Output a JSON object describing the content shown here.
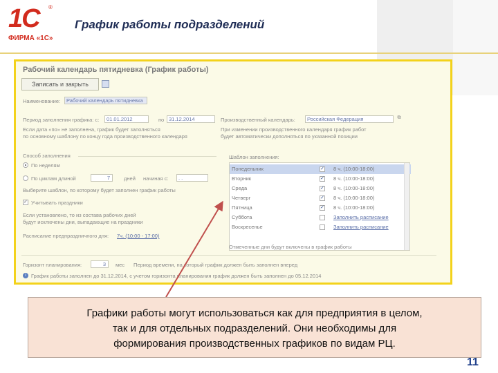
{
  "slide": {
    "brand_mark": "1С",
    "brand_name": "ФИРМА «1С»",
    "title": "График работы подразделений",
    "page_number": "11"
  },
  "form": {
    "title": "Рабочий календарь пятидневка (График работы)",
    "save_close_label": "Записать и закрыть",
    "name_label": "Наименование:",
    "name_value": "Рабочий календарь пятидневка",
    "period_label": "Период заполнения графика: с:",
    "period_from": "01.01.2012",
    "period_to_label": "по",
    "period_to": "31.12.2014",
    "prod_calendar_label": "Производственный календарь:",
    "prod_calendar_value": "Российская Федерация",
    "period_hint_1": "Если дата «по» не заполнена, график будет заполняться",
    "period_hint_2": "по основному шаблону по концу года производственного календаря",
    "prod_hint_1": "При изменении производственного календаря график работ",
    "prod_hint_2": "будет автоматически дополняться по указанной позиции",
    "fill_method_title": "Способ заполнения",
    "by_weeks_label": "По неделям",
    "by_cycle_label": "По циклам длиной",
    "cycle_length": "7",
    "days_label": "дней",
    "start_label": "начиная с:",
    "start_value": ". .",
    "choose_template_hint": "Выберите шаблон, по которому будет заполнен график работы",
    "holidays_label": "Учитывать праздники",
    "holidays_hint_1": "Если установлено, то из состава рабочих дней",
    "holidays_hint_2": "будут исключены дни, выпадающие на праздники",
    "preholiday_label": "Расписание предпраздничного дня:",
    "preholiday_value": "7ч. (10:00 - 17:00)",
    "template_title": "Шаблон заполнения:",
    "template_days": [
      {
        "day": "Понедельник",
        "checked": true,
        "time": "8 ч. (10:00-18:00)",
        "active": true
      },
      {
        "day": "Вторник",
        "checked": true,
        "time": "8 ч. (10:00-18:00)",
        "active": false
      },
      {
        "day": "Среда",
        "checked": true,
        "time": "8 ч. (10:00-18:00)",
        "active": false
      },
      {
        "day": "Четверг",
        "checked": true,
        "time": "8 ч. (10:00-18:00)",
        "active": false
      },
      {
        "day": "Пятница",
        "checked": true,
        "time": "8 ч. (10:00-18:00)",
        "active": false
      },
      {
        "day": "Суббота",
        "checked": false,
        "time": "Заполнить расписание",
        "active": false
      },
      {
        "day": "Воскресенье",
        "checked": false,
        "time": "Заполнить расписание",
        "active": false
      }
    ],
    "template_hint": "Отмеченные дни будут включены в график работы",
    "horizon_label": "Горизонт планирования:",
    "horizon_value": "3",
    "horizon_unit": "мес",
    "horizon_hint": "Период времени, на который график должен быть заполнен вперед",
    "status_text": "График работы заполнен до 31.12.2014, с учетом горизонта планирования график должен быть заполнен до 05.12.2014"
  },
  "callout": {
    "line_1": "Графики работы могут использоваться как для предприятия в целом,",
    "line_2": "так и для отдельных подразделений. Они необходимы для",
    "line_3": "формирования производственных графиков по видам РЦ."
  },
  "colors": {
    "frame_border": "#f3d21b",
    "callout_bg": "#f9e2d5",
    "arrow": "#c0504d",
    "brand": "#d22b1e"
  }
}
